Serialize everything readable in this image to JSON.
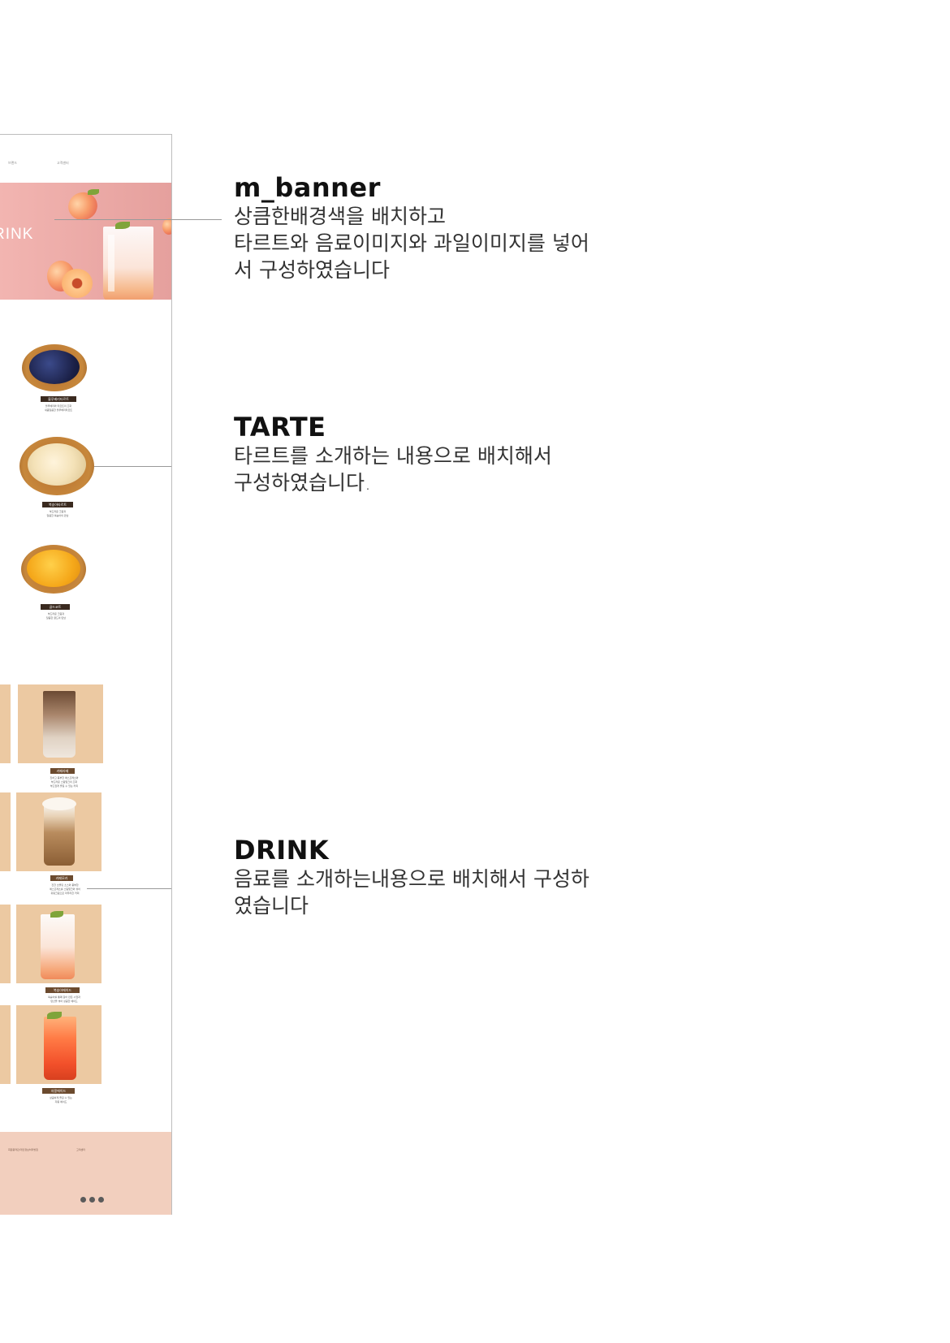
{
  "mockup": {
    "nav": [
      "브랜드",
      "고객센터"
    ],
    "banner_text": "RINK",
    "tarts": [
      {
        "name": "블루베리타르트",
        "caption": "블루베리와 타르트의 조화\n새콤달콤한 블루베리타르트"
      },
      {
        "name": "복숭아타르트",
        "caption": "부드러운 크림과\n달콤한 복숭아의 만남"
      },
      {
        "name": "골드코트",
        "caption": "부드러운 크림과\n달콤한 골드의 만남"
      }
    ],
    "drinks": [
      {
        "name": "카페라떼",
        "caption": "진하고 풍부한 에스프레소와\n부드러운 스팀밀크의 조화\n부드럽게 즐길 수 있는 커피"
      },
      {
        "name": "카페모카",
        "caption": "진한 초콜릿 소스와 풍부한\n에스프레소를 스팀밀크와 섞어\n휘핑크림으로 마무리한 커피"
      },
      {
        "name": "복숭아에이드",
        "caption": "복숭아를 통째 갈아 만든 시럽과\n탄산을 넣어 상큼한 에이드"
      },
      {
        "name": "자몽에이드",
        "caption": "상큼하게 즐길 수 있는\n자몽 에이드"
      }
    ],
    "footer": [
      "회원용약관/개인정보처리방침",
      "고객센터"
    ],
    "sns_icons": [
      "instagram-icon",
      "facebook-icon",
      "youtube-icon"
    ],
    "colors": {
      "banner": "#eba9a6",
      "drink_card": "#ecc9a2",
      "footer": "#f2cfbe",
      "tart_label": "#3a2a1f",
      "drink_label": "#6b4a2e"
    }
  },
  "notes": [
    {
      "title": "m_banner",
      "body": "상큼한배경색을 배치하고\n타르트와 음료이미지와 과일이미지를 넣어\n서 구성하였습니다"
    },
    {
      "title": "TARTE",
      "body": "타르트를 소개하는 내용으로 배치해서\n구성하였습니다."
    },
    {
      "title": "DRINK",
      "body": "음료를 소개하는내용으로 배치해서 구성하\n였습니다"
    }
  ]
}
